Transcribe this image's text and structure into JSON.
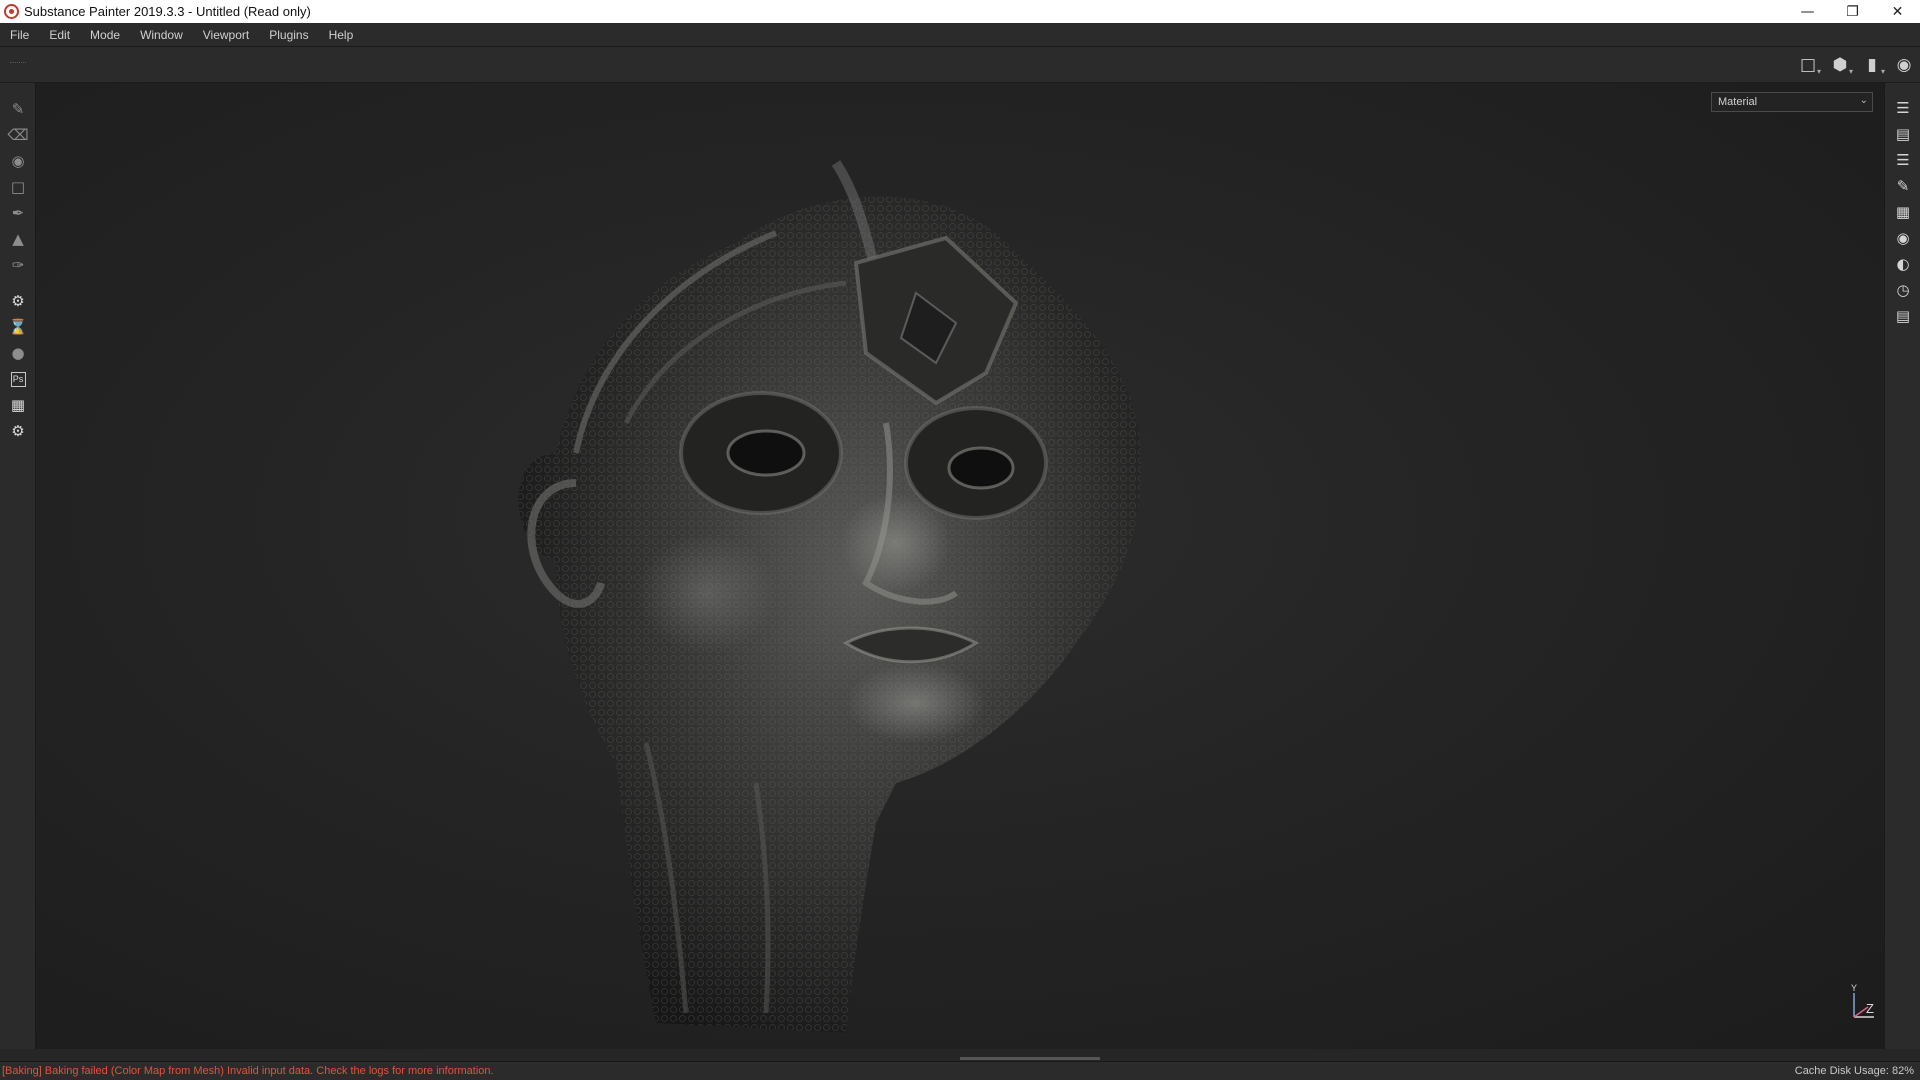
{
  "window": {
    "title": "Substance Painter 2019.3.3 - Untitled (Read only)",
    "controls": [
      "minimize-icon",
      "restore-icon",
      "close-icon"
    ]
  },
  "menu": [
    "File",
    "Edit",
    "Mode",
    "Window",
    "Viewport",
    "Plugins",
    "Help"
  ],
  "view_tools": [
    "2d-view-icon",
    "3d-view-icon",
    "camera-icon",
    "screenshot-icon"
  ],
  "left_tools": [
    "paint-brush-icon",
    "eraser-icon",
    "projection-icon",
    "polygon-fill-icon",
    "smudge-icon",
    "clone-stamp-icon",
    "color-picker-icon",
    "bake-settings-icon",
    "hourglass-icon",
    "material-ball-icon",
    "photoshop-icon",
    "export-icon",
    "settings-icon"
  ],
  "right_tools": [
    "layers-panel-icon",
    "texture-set-list-icon",
    "layer-stack-icon",
    "brush-properties-icon",
    "uv-grid-icon",
    "display-settings-icon",
    "environment-icon",
    "history-icon",
    "log-icon"
  ],
  "viewport": {
    "channel_select": "Material",
    "axis_gizmo": {
      "y": "Y",
      "z": "Z"
    }
  },
  "status": {
    "error": "[Baking] Baking failed (Color Map from Mesh) Invalid input data. Check the logs for more information.",
    "cache_label": "Cache Disk Usage:",
    "cache_value": "82%"
  },
  "colors": {
    "background": "#1e1e1e",
    "panel": "#2b2b2b",
    "error": "#e0533e"
  }
}
